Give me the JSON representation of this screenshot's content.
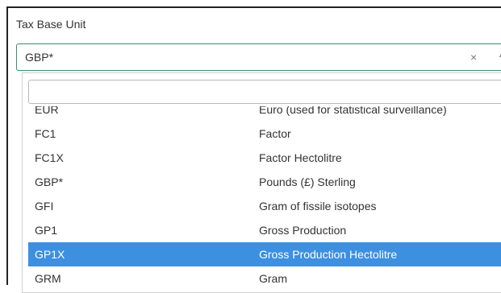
{
  "field": {
    "label": "Tax Base Unit"
  },
  "select": {
    "value": "GBP*",
    "clear_icon": "×",
    "caret_icon": "▲"
  },
  "search": {
    "placeholder": "",
    "value": ""
  },
  "options": [
    {
      "code": "EUR",
      "description": "Euro (used for statistical surveillance)",
      "selected": false
    },
    {
      "code": "FC1",
      "description": "Factor",
      "selected": false
    },
    {
      "code": "FC1X",
      "description": "Factor Hectolitre",
      "selected": false
    },
    {
      "code": "GBP*",
      "description": "Pounds (£) Sterling",
      "selected": false
    },
    {
      "code": "GFI",
      "description": "Gram of fissile isotopes",
      "selected": false
    },
    {
      "code": "GP1",
      "description": "Gross Production",
      "selected": false
    },
    {
      "code": "GP1X",
      "description": "Gross Production Hectolitre",
      "selected": true
    },
    {
      "code": "GRM",
      "description": "Gram",
      "selected": false
    }
  ],
  "colors": {
    "accent": "#3c8c6e",
    "selected_bg": "#3d8fe0"
  }
}
